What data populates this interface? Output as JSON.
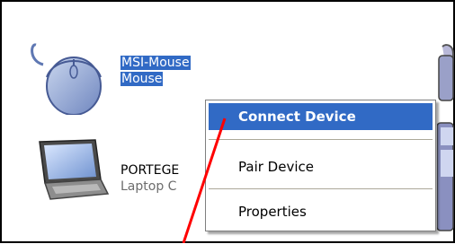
{
  "devices": [
    {
      "name": "MSI-Mouse",
      "type": "Mouse",
      "icon": "mouse-icon",
      "selected": true
    },
    {
      "name": "PORTEGE",
      "type": "Laptop C",
      "icon": "laptop-icon",
      "selected": false
    },
    {
      "icon": "phone-icon"
    }
  ],
  "context_menu": {
    "items": [
      {
        "label": "Connect Device",
        "highlighted": true
      },
      {
        "label": "Pair Device",
        "highlighted": false
      },
      {
        "label": "Properties",
        "highlighted": false
      }
    ]
  },
  "colors": {
    "selection": "#316ac5",
    "annotation": "#ff0000",
    "frame": "#000000"
  }
}
